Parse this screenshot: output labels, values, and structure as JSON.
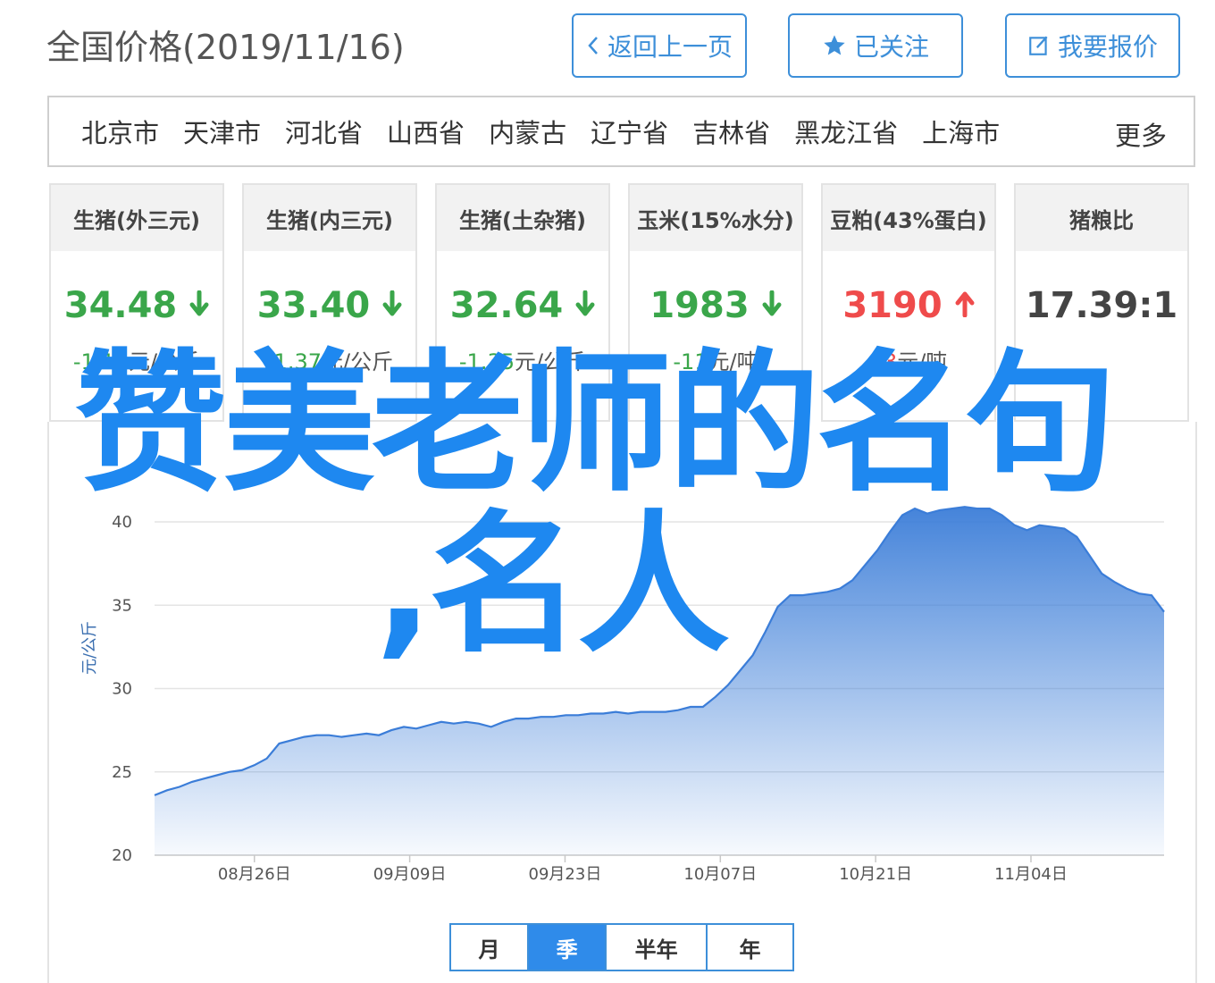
{
  "header": {
    "title": "全国价格(2019/11/16)",
    "back_label": "返回上一页",
    "follow_label": "已关注",
    "report_label": "我要报价"
  },
  "regions": {
    "items": [
      "北京市",
      "天津市",
      "河北省",
      "山西省",
      "内蒙古",
      "辽宁省",
      "吉林省",
      "黑龙江省",
      "上海市"
    ],
    "more_label": "更多"
  },
  "cards": [
    {
      "title": "生猪(外三元)",
      "value": "34.48",
      "change_num": "-1.12",
      "change_unit": "元/公斤",
      "trend": "down"
    },
    {
      "title": "生猪(内三元)",
      "value": "33.40",
      "change_num": "-1.37",
      "change_unit": "元/公斤",
      "trend": "down"
    },
    {
      "title": "生猪(土杂猪)",
      "value": "32.64",
      "change_num": "-1.35",
      "change_unit": "元/公斤",
      "trend": "down"
    },
    {
      "title": "玉米(15%水分)",
      "value": "1983",
      "change_num": "-11",
      "change_unit": "元/吨",
      "trend": "down"
    },
    {
      "title": "豆粕(43%蛋白)",
      "value": "3190",
      "change_num": "13",
      "change_unit": "元/吨",
      "trend": "up"
    },
    {
      "title": "猪粮比",
      "value": "17.39:1",
      "change_num": "",
      "change_unit": "",
      "trend": "none"
    }
  ],
  "colors": {
    "accent": "#3d8fd9",
    "down": "#3aa64a",
    "up": "#ef4b4b",
    "line": "#3b7dd8",
    "overlay": "#1e88f0"
  },
  "chart_data": {
    "type": "area",
    "ylabel": "元/公斤",
    "ylim": [
      20,
      42
    ],
    "yticks": [
      20,
      25,
      30,
      35,
      40
    ],
    "xtick_labels": [
      "08月26日",
      "09月09日",
      "09月23日",
      "10月07日",
      "10月21日",
      "11月04日"
    ],
    "x_start": "2019-08-17",
    "x_end": "2019-11-16",
    "grid": true,
    "series": [
      {
        "values": [
          23.6,
          23.9,
          24.1,
          24.4,
          24.6,
          24.8,
          25.0,
          25.1,
          25.4,
          25.8,
          26.7,
          26.9,
          27.1,
          27.2,
          27.2,
          27.1,
          27.2,
          27.3,
          27.2,
          27.5,
          27.7,
          27.6,
          27.8,
          28.0,
          27.9,
          28.0,
          27.9,
          27.7,
          28.0,
          28.2,
          28.2,
          28.3,
          28.3,
          28.4,
          28.4,
          28.5,
          28.5,
          28.6,
          28.5,
          28.6,
          28.6,
          28.6,
          28.7,
          28.9,
          28.9,
          29.5,
          30.2,
          31.1,
          32.0,
          33.4,
          34.9,
          35.6,
          35.6,
          35.7,
          35.8,
          36.0,
          36.5,
          37.4,
          38.3,
          39.4,
          40.4,
          40.8,
          40.5,
          40.7,
          40.8,
          40.9,
          40.8,
          40.8,
          40.4,
          39.8,
          39.5,
          39.8,
          39.7,
          39.6,
          39.1,
          38.0,
          36.9,
          36.4,
          36.0,
          35.7,
          35.6,
          34.6
        ]
      }
    ]
  },
  "watermark": {
    "line1": "赞美老师的名句",
    "line2": ",名人"
  },
  "periods": {
    "tabs": [
      "月",
      "季",
      "半年",
      "年"
    ],
    "active": "季"
  }
}
